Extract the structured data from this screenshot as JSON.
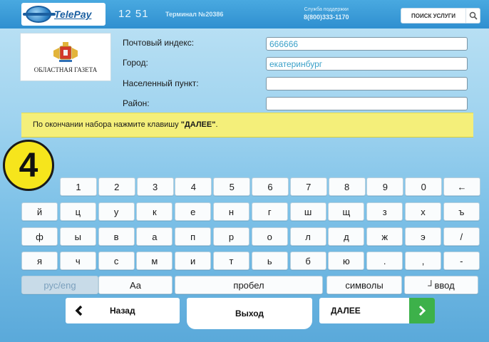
{
  "header": {
    "logo_text": "TelePay",
    "clock": "12 51",
    "terminal": "Терминал №20386",
    "support_line1": "Служба поддержки",
    "support_phone": "8(800)333-1170",
    "search_label": "ПОИСК УСЛУГИ",
    "search_icon": "magnifier-icon"
  },
  "brand": {
    "name": "ОБЛАСТНАЯ ГАЗЕТА"
  },
  "form": {
    "fields": [
      {
        "label": "Почтовый индекс:",
        "value": "666666"
      },
      {
        "label": "Город:",
        "value": "екатеринбург"
      },
      {
        "label": "Населенный пункт:",
        "value": ""
      },
      {
        "label": "Район:",
        "value": ""
      }
    ]
  },
  "notice": {
    "text_before": "По окончании набора нажмите клавишу ",
    "emphasis": "\"ДАЛЕЕ\"",
    "text_after": "."
  },
  "step": {
    "number": "4"
  },
  "keyboard": {
    "row1": [
      "1",
      "2",
      "3",
      "4",
      "5",
      "6",
      "7",
      "8",
      "9",
      "0",
      "←"
    ],
    "row2": [
      "й",
      "ц",
      "у",
      "к",
      "е",
      "н",
      "г",
      "ш",
      "щ",
      "з",
      "х",
      "ъ"
    ],
    "row3": [
      "ф",
      "ы",
      "в",
      "а",
      "п",
      "р",
      "о",
      "л",
      "д",
      "ж",
      "э",
      "/"
    ],
    "row4": [
      "я",
      "ч",
      "с",
      "м",
      "и",
      "т",
      "ь",
      "б",
      "ю",
      ".",
      ",",
      "-"
    ],
    "lang": "рус/eng",
    "shift": "Аа",
    "space": "пробел",
    "symbols": "символы",
    "enter": "┘ввод"
  },
  "nav": {
    "back": "Назад",
    "exit": "Выход",
    "next": "ДАЛЕЕ"
  },
  "colors": {
    "header_blue": "#2f8fd0",
    "notice_yellow": "#f4ef7a",
    "step_yellow": "#f6e51c",
    "next_green": "#3db14a"
  }
}
